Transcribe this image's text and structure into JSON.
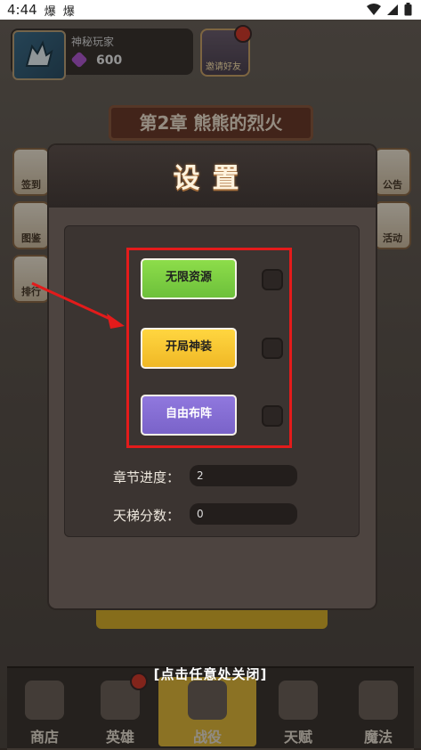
{
  "status_bar": {
    "time": "4:44",
    "notif_icons": "爆 爆"
  },
  "profile": {
    "name": "神秘玩家",
    "gems": "600"
  },
  "invite": {
    "label": "邀请好友"
  },
  "chapter": {
    "title": "第2章 熊熊的烈火"
  },
  "side_buttons": {
    "left_top": "签到",
    "left_mid": "图鉴",
    "left_bot": "排行",
    "right_top": "公告",
    "right_mid": "活动"
  },
  "dialog": {
    "title": "设置",
    "options": [
      {
        "label": "无限资源",
        "color": "#7ccf44"
      },
      {
        "label": "开局神装",
        "color": "#f6c82f"
      },
      {
        "label": "自由布阵",
        "color": "#8570d6"
      }
    ],
    "fields": [
      {
        "label": "章节进度：",
        "value": "2"
      },
      {
        "label": "天梯分数：",
        "value": "0"
      }
    ]
  },
  "close_hint": "[点击任意处关闭]",
  "bottom_nav": [
    {
      "label": "商店"
    },
    {
      "label": "英雄"
    },
    {
      "label": "战役"
    },
    {
      "label": "天赋"
    },
    {
      "label": "魔法"
    }
  ],
  "colors": {
    "highlight": "#e31b1b",
    "accent": "#e0b93a"
  }
}
